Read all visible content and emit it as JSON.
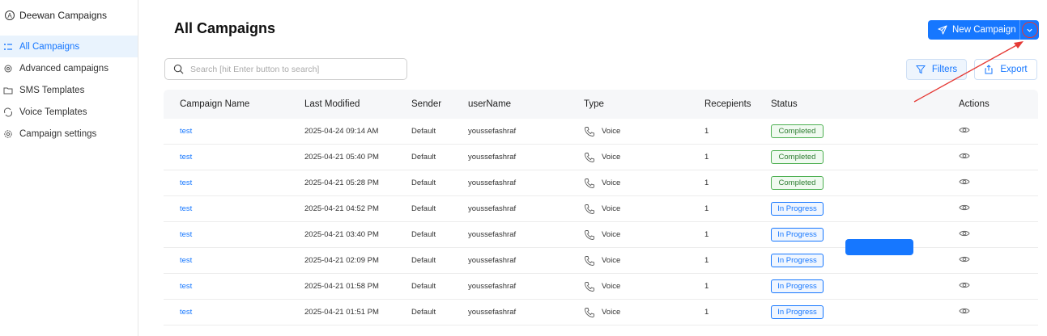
{
  "sidebar": {
    "brand": "Deewan Campaigns",
    "items": [
      {
        "label": "All Campaigns",
        "icon": "list-icon",
        "active": true
      },
      {
        "label": "Advanced campaigns",
        "icon": "cog-sparkle-icon"
      },
      {
        "label": "SMS Templates",
        "icon": "folder-icon"
      },
      {
        "label": "Voice Templates",
        "icon": "voice-swap-icon"
      },
      {
        "label": "Campaign settings",
        "icon": "gear-icon"
      }
    ]
  },
  "header": {
    "title": "All Campaigns",
    "new_campaign_label": "New Campaign",
    "search_placeholder": "Search [hit Enter button to search]",
    "filters_label": "Filters",
    "export_label": "Export"
  },
  "table": {
    "columns": [
      "Campaign Name",
      "Last Modified",
      "Sender",
      "userName",
      "Type",
      "Recepients",
      "Status",
      "Actions"
    ],
    "rows": [
      {
        "name": "test",
        "modified": "2025-04-24 09:14 AM",
        "sender": "Default",
        "user": "youssefashraf",
        "type": "Voice",
        "recipients": "1",
        "status": "Completed"
      },
      {
        "name": "test",
        "modified": "2025-04-21 05:40 PM",
        "sender": "Default",
        "user": "youssefashraf",
        "type": "Voice",
        "recipients": "1",
        "status": "Completed"
      },
      {
        "name": "test",
        "modified": "2025-04-21 05:28 PM",
        "sender": "Default",
        "user": "youssefashraf",
        "type": "Voice",
        "recipients": "1",
        "status": "Completed"
      },
      {
        "name": "test",
        "modified": "2025-04-21 04:52 PM",
        "sender": "Default",
        "user": "youssefashraf",
        "type": "Voice",
        "recipients": "1",
        "status": "In Progress"
      },
      {
        "name": "test",
        "modified": "2025-04-21 03:40 PM",
        "sender": "Default",
        "user": "youssefashraf",
        "type": "Voice",
        "recipients": "1",
        "status": "In Progress"
      },
      {
        "name": "test",
        "modified": "2025-04-21 02:09 PM",
        "sender": "Default",
        "user": "youssefashraf",
        "type": "Voice",
        "recipients": "1",
        "status": "In Progress"
      },
      {
        "name": "test",
        "modified": "2025-04-21 01:58 PM",
        "sender": "Default",
        "user": "youssefashraf",
        "type": "Voice",
        "recipients": "1",
        "status": "In Progress"
      },
      {
        "name": "test",
        "modified": "2025-04-21 01:51 PM",
        "sender": "Default",
        "user": "youssefashraf",
        "type": "Voice",
        "recipients": "1",
        "status": "In Progress"
      }
    ]
  },
  "colors": {
    "accent": "#1677ff",
    "completed": "#4caf50",
    "annotation": "#e53935"
  }
}
